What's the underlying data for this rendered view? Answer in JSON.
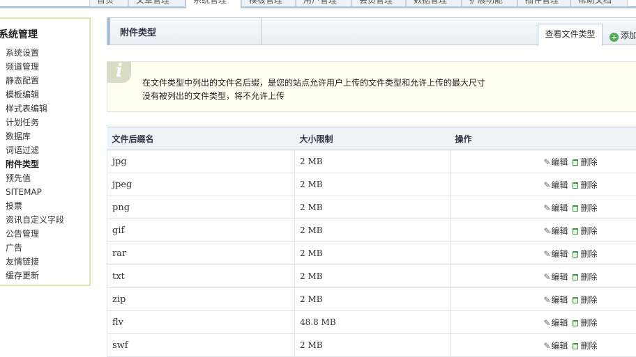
{
  "top_nav": {
    "tabs": [
      {
        "label": "首页"
      },
      {
        "label": "文章管理"
      },
      {
        "label": "系统管理",
        "active": true
      },
      {
        "label": "模板管理"
      },
      {
        "label": "用户管理"
      },
      {
        "label": "会员管理"
      },
      {
        "label": "数据管理"
      },
      {
        "label": "扩展功能"
      },
      {
        "label": "插件管理"
      },
      {
        "label": "帮助文档"
      }
    ]
  },
  "sidebar": {
    "title": "系统管理",
    "items": [
      {
        "label": "系统设置"
      },
      {
        "label": "频道管理"
      },
      {
        "label": "静态配置"
      },
      {
        "label": "模板编辑"
      },
      {
        "label": "样式表编辑"
      },
      {
        "label": "计划任务"
      },
      {
        "label": "数据库"
      },
      {
        "label": "词语过滤"
      },
      {
        "label": "附件类型",
        "active": true
      },
      {
        "label": "预先值"
      },
      {
        "label": "SITEMAP"
      },
      {
        "label": "投票"
      },
      {
        "label": "资讯自定义字段"
      },
      {
        "label": "公告管理"
      },
      {
        "label": "广告"
      },
      {
        "label": "友情链接"
      },
      {
        "label": "缓存更新"
      }
    ]
  },
  "header": {
    "title": "附件类型",
    "view_tab": "查看文件类型",
    "add_link": "添加"
  },
  "info": {
    "icon": "info-icon",
    "line1": "在文件类型中列出的文件名后缀，是您的站点允许用户上传的文件类型和允许上传的最大尺寸",
    "line2": "没有被列出的文件类型，将不允许上传"
  },
  "table": {
    "columns": [
      "文件后缀名",
      "大小限制",
      "操作"
    ],
    "edit_label": "编辑",
    "delete_label": "删除",
    "rows": [
      {
        "ext": "jpg",
        "size": "2 MB"
      },
      {
        "ext": "jpeg",
        "size": "2 MB"
      },
      {
        "ext": "png",
        "size": "2 MB"
      },
      {
        "ext": "gif",
        "size": "2 MB"
      },
      {
        "ext": "rar",
        "size": "2 MB"
      },
      {
        "ext": "txt",
        "size": "2 MB"
      },
      {
        "ext": "zip",
        "size": "2 MB"
      },
      {
        "ext": "flv",
        "size": "48.8 MB"
      },
      {
        "ext": "swf",
        "size": "2 MB"
      }
    ]
  },
  "colors": {
    "sidebar_border": "#dde4b4",
    "header_border": "#b7c7d8",
    "info_bg": "#fffef0",
    "delete_icon": "#3a9a3a"
  }
}
